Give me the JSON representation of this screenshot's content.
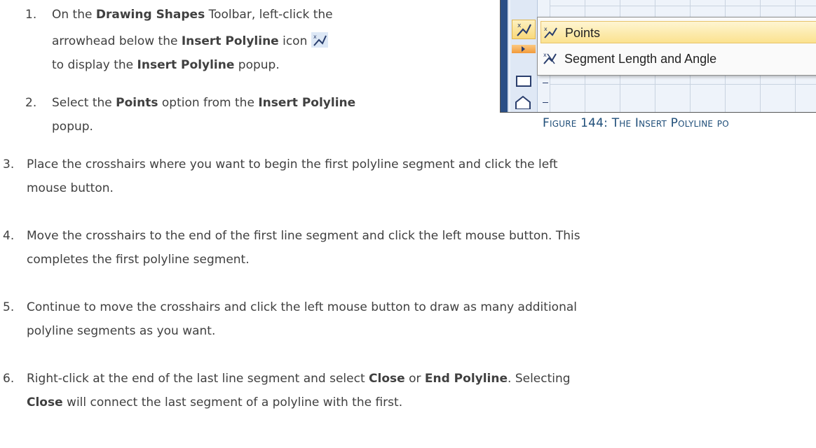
{
  "steps": [
    {
      "number": "1.",
      "line1_pre": "On the ",
      "line1_bold": "Drawing Shapes",
      "line1_post": " Toolbar, left-click the",
      "line2_pre": "arrowhead below the ",
      "line2_bold": "Insert Polyline",
      "line2_post": " icon",
      "line3_pre": "to display the ",
      "line3_bold": "Insert Polyline",
      "line3_post": " popup."
    },
    {
      "number": "2.",
      "line1_pre": "Select the ",
      "line1_bold": "Points",
      "line1_mid": " option from the ",
      "line1_bold2": "Insert Polyline",
      "line2": "popup."
    },
    {
      "number": "3.",
      "line1": "Place the crosshairs where you want to begin the first polyline segment and click the left",
      "line2": "mouse button."
    },
    {
      "number": "4.",
      "line1": "Move the crosshairs to the end of the first line segment and click the left mouse button. This",
      "line2": "completes the first polyline segment."
    },
    {
      "number": "5.",
      "line1": "Continue to move the crosshairs and click the left mouse button to draw as many additional",
      "line2": "polyline segments as you want."
    },
    {
      "number": "6.",
      "line1_pre": "Right-click at the end of the last line segment and select ",
      "line1_bold": "Close",
      "line1_mid": " or ",
      "line1_bold2": "End Polyline",
      "line1_post": ". Selecting",
      "line2_bold": "Close",
      "line2_post": " will connect the last segment of a polyline with the first."
    }
  ],
  "figure": {
    "popup_items": [
      {
        "label": "Points",
        "icon": "polyline-points-icon",
        "highlighted": true
      },
      {
        "label": "Segment Length and Angle",
        "icon": "polyline-segment-icon",
        "highlighted": false
      }
    ],
    "toolbar_icons": [
      "polyline-points-icon",
      "dropdown-arrow-icon",
      "rectangle-icon",
      "pentagon-icon"
    ]
  },
  "caption": {
    "prefix": "Figure 144: The Insert Polyline po"
  },
  "colors": {
    "text": "#404040",
    "caption": "#1f4e79",
    "highlight": "#fbe28f",
    "toolbar_blue": "#2b4f86"
  }
}
